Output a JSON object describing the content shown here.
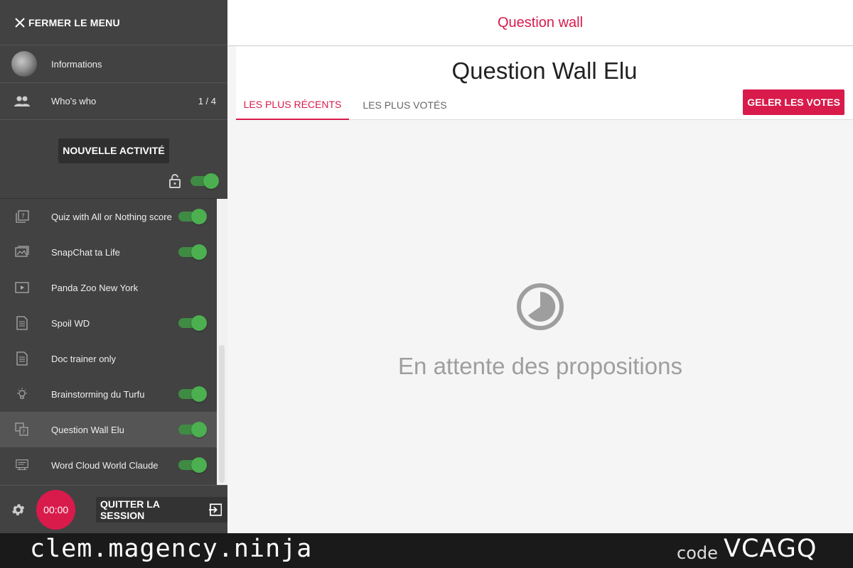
{
  "sidebar": {
    "close_label": "FERMER LE MENU",
    "info_label": "Informations",
    "who_label": "Who's who",
    "who_count": "1 / 4",
    "new_activity_label": "NOUVELLE ACTIVITÉ",
    "activities": [
      {
        "name": "Quiz with All or Nothing score",
        "icon": "quiz-icon",
        "enabled": true
      },
      {
        "name": "SnapChat ta Life",
        "icon": "image-icon",
        "enabled": true
      },
      {
        "name": "Panda Zoo New York",
        "icon": "video-icon",
        "enabled": null
      },
      {
        "name": "Spoil WD",
        "icon": "document-icon",
        "enabled": true
      },
      {
        "name": "Doc trainer only",
        "icon": "document-icon",
        "enabled": null
      },
      {
        "name": "Brainstorming du Turfu",
        "icon": "lightbulb-icon",
        "enabled": true
      },
      {
        "name": "Question Wall Elu",
        "icon": "question-wall-icon",
        "enabled": true,
        "active": true
      },
      {
        "name": "Word Cloud World Claude",
        "icon": "word-cloud-icon",
        "enabled": true
      }
    ],
    "timer": "00:00",
    "quit_label": "QUITTER LA SESSION"
  },
  "main": {
    "topbar_title": "Question wall",
    "page_title": "Question Wall Elu",
    "tabs": [
      "LES PLUS RÉCENTS",
      "LES PLUS VOTÉS"
    ],
    "freeze_label": "GELER LES VOTES",
    "empty_message": "En attente des propositions"
  },
  "footer": {
    "domain": "clem.magency.ninja",
    "code_label": "code",
    "code_value": "VCAGQ"
  },
  "colors": {
    "accent": "#d81b4b",
    "sidebar_bg": "#424242",
    "toggle_on": "#4caf50"
  }
}
